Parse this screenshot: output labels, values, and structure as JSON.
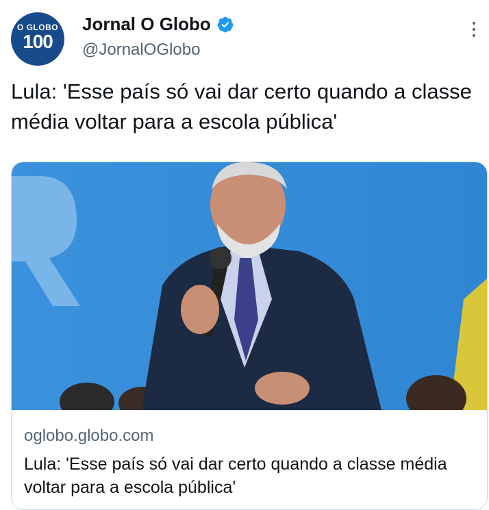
{
  "tweet": {
    "display_name": "Jornal O Globo",
    "handle": "@JornalOGlobo",
    "avatar_brand": "O GLOBO",
    "avatar_number": "100",
    "text": "Lula: 'Esse país só vai dar certo quando a classe média voltar para a escola pública'"
  },
  "card": {
    "domain": "oglobo.globo.com",
    "title": "Lula: 'Esse país só vai dar certo quando a classe média voltar para a escola pública'"
  },
  "colors": {
    "verified": "#1d9bf0",
    "avatar_bg": "#184b8c",
    "image_bg": "#3a8fd6"
  },
  "icons": [
    "verified-badge-icon",
    "more-options-icon"
  ]
}
